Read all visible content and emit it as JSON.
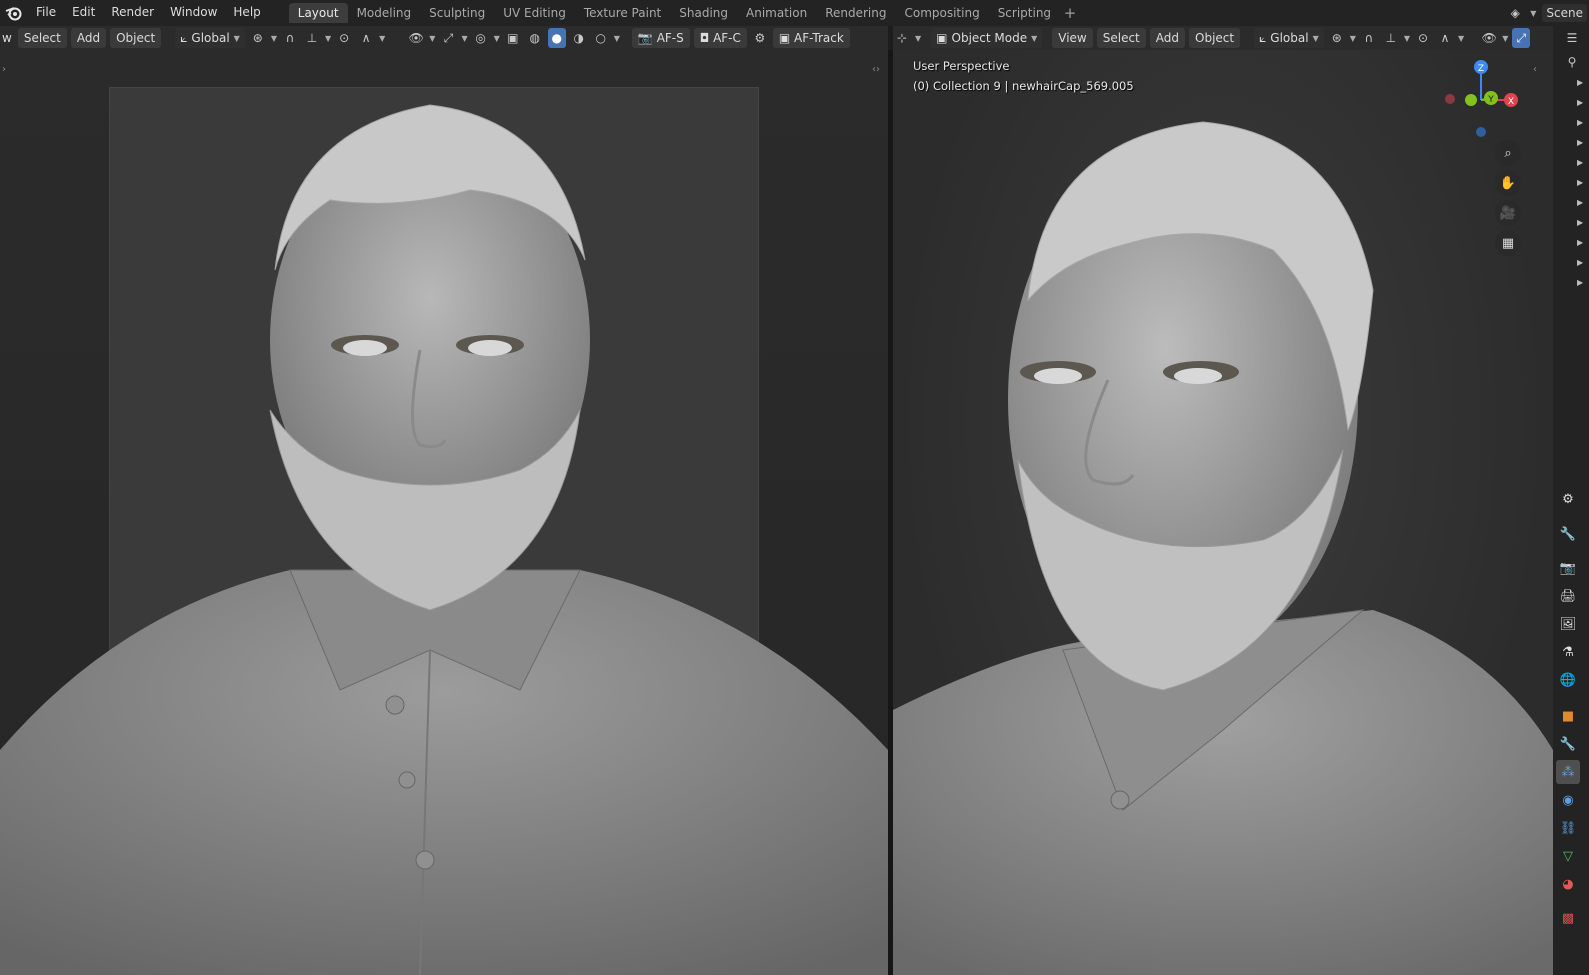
{
  "menu": {
    "file": "File",
    "edit": "Edit",
    "render": "Render",
    "window": "Window",
    "help": "Help"
  },
  "workspaces": [
    "Layout",
    "Modeling",
    "Sculpting",
    "UV Editing",
    "Texture Paint",
    "Shading",
    "Animation",
    "Rendering",
    "Compositing",
    "Scripting"
  ],
  "scene_label": "Scene",
  "left_toolbar": {
    "select": "Select",
    "add": "Add",
    "object": "Object",
    "orientation": "Global",
    "af_s": "AF-S",
    "af_c": "AF-C",
    "af_track": "AF-Track"
  },
  "right_toolbar": {
    "mode": "Object Mode",
    "view": "View",
    "select": "Select",
    "add": "Add",
    "object": "Object",
    "orientation": "Global"
  },
  "right_viewport": {
    "perspective": "User Perspective",
    "collection": "(0) Collection 9 | newhairCap_569.005"
  },
  "gizmo_axes": {
    "z": "Z",
    "x": "X",
    "y": "Y"
  },
  "colors": {
    "accent": "#4772b3",
    "x_axis": "#e0434d",
    "y_axis": "#83c11d",
    "z_axis": "#3d8bf2"
  }
}
